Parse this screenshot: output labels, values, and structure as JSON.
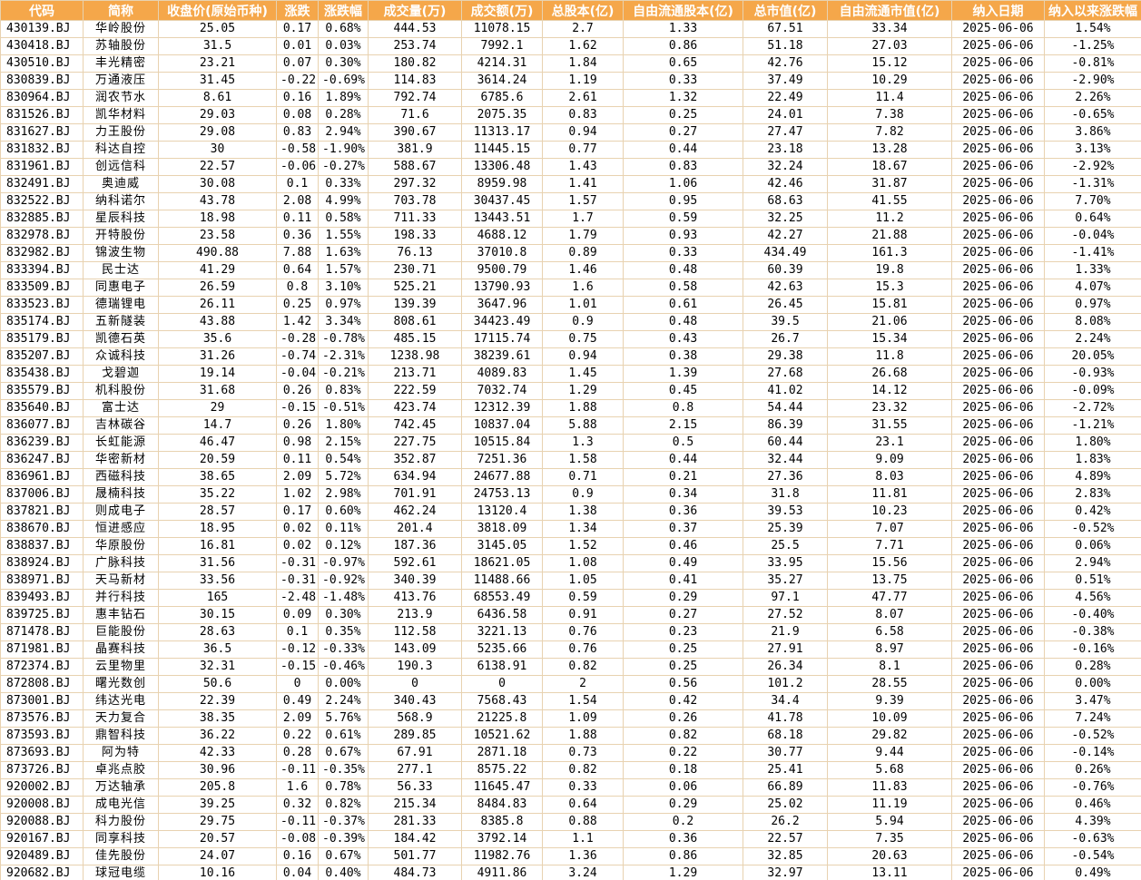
{
  "header": [
    "代码",
    "简称",
    "收盘价(原始币种)",
    "涨跌",
    "涨跌幅",
    "成交量(万)",
    "成交额(万)",
    "总股本(亿)",
    "自由流通股本(亿)",
    "总市值(亿)",
    "自由流通市值(亿)",
    "纳入日期",
    "纳入以来涨跌幅"
  ],
  "rows": [
    [
      "430139.BJ",
      "华岭股份",
      "25.05",
      "0.17",
      "0.68%",
      "444.53",
      "11078.15",
      "2.7",
      "1.33",
      "67.51",
      "33.34",
      "2025-06-06",
      "1.54%"
    ],
    [
      "430418.BJ",
      "苏轴股份",
      "31.5",
      "0.01",
      "0.03%",
      "253.74",
      "7992.1",
      "1.62",
      "0.86",
      "51.18",
      "27.03",
      "2025-06-06",
      "-1.25%"
    ],
    [
      "430510.BJ",
      "丰光精密",
      "23.21",
      "0.07",
      "0.30%",
      "180.82",
      "4214.31",
      "1.84",
      "0.65",
      "42.76",
      "15.12",
      "2025-06-06",
      "-0.81%"
    ],
    [
      "830839.BJ",
      "万通液压",
      "31.45",
      "-0.22",
      "-0.69%",
      "114.83",
      "3614.24",
      "1.19",
      "0.33",
      "37.49",
      "10.29",
      "2025-06-06",
      "-2.90%"
    ],
    [
      "830964.BJ",
      "润农节水",
      "8.61",
      "0.16",
      "1.89%",
      "792.74",
      "6785.6",
      "2.61",
      "1.32",
      "22.49",
      "11.4",
      "2025-06-06",
      "2.26%"
    ],
    [
      "831526.BJ",
      "凯华材料",
      "29.03",
      "0.08",
      "0.28%",
      "71.6",
      "2075.35",
      "0.83",
      "0.25",
      "24.01",
      "7.38",
      "2025-06-06",
      "-0.65%"
    ],
    [
      "831627.BJ",
      "力王股份",
      "29.08",
      "0.83",
      "2.94%",
      "390.67",
      "11313.17",
      "0.94",
      "0.27",
      "27.47",
      "7.82",
      "2025-06-06",
      "3.86%"
    ],
    [
      "831832.BJ",
      "科达自控",
      "30",
      "-0.58",
      "-1.90%",
      "381.9",
      "11445.15",
      "0.77",
      "0.44",
      "23.18",
      "13.28",
      "2025-06-06",
      "3.13%"
    ],
    [
      "831961.BJ",
      "创远信科",
      "22.57",
      "-0.06",
      "-0.27%",
      "588.67",
      "13306.48",
      "1.43",
      "0.83",
      "32.24",
      "18.67",
      "2025-06-06",
      "-2.92%"
    ],
    [
      "832491.BJ",
      "奥迪威",
      "30.08",
      "0.1",
      "0.33%",
      "297.32",
      "8959.98",
      "1.41",
      "1.06",
      "42.46",
      "31.87",
      "2025-06-06",
      "-1.31%"
    ],
    [
      "832522.BJ",
      "纳科诺尔",
      "43.78",
      "2.08",
      "4.99%",
      "703.78",
      "30437.45",
      "1.57",
      "0.95",
      "68.63",
      "41.55",
      "2025-06-06",
      "7.70%"
    ],
    [
      "832885.BJ",
      "星辰科技",
      "18.98",
      "0.11",
      "0.58%",
      "711.33",
      "13443.51",
      "1.7",
      "0.59",
      "32.25",
      "11.2",
      "2025-06-06",
      "0.64%"
    ],
    [
      "832978.BJ",
      "开特股份",
      "23.58",
      "0.36",
      "1.55%",
      "198.33",
      "4688.12",
      "1.79",
      "0.93",
      "42.27",
      "21.88",
      "2025-06-06",
      "-0.04%"
    ],
    [
      "832982.BJ",
      "锦波生物",
      "490.88",
      "7.88",
      "1.63%",
      "76.13",
      "37010.8",
      "0.89",
      "0.33",
      "434.49",
      "161.3",
      "2025-06-06",
      "-1.41%"
    ],
    [
      "833394.BJ",
      "民士达",
      "41.29",
      "0.64",
      "1.57%",
      "230.71",
      "9500.79",
      "1.46",
      "0.48",
      "60.39",
      "19.8",
      "2025-06-06",
      "1.33%"
    ],
    [
      "833509.BJ",
      "同惠电子",
      "26.59",
      "0.8",
      "3.10%",
      "525.21",
      "13790.93",
      "1.6",
      "0.58",
      "42.63",
      "15.3",
      "2025-06-06",
      "4.07%"
    ],
    [
      "833523.BJ",
      "德瑞锂电",
      "26.11",
      "0.25",
      "0.97%",
      "139.39",
      "3647.96",
      "1.01",
      "0.61",
      "26.45",
      "15.81",
      "2025-06-06",
      "0.97%"
    ],
    [
      "835174.BJ",
      "五新隧装",
      "43.88",
      "1.42",
      "3.34%",
      "808.61",
      "34423.49",
      "0.9",
      "0.48",
      "39.5",
      "21.06",
      "2025-06-06",
      "8.08%"
    ],
    [
      "835179.BJ",
      "凯德石英",
      "35.6",
      "-0.28",
      "-0.78%",
      "485.15",
      "17115.74",
      "0.75",
      "0.43",
      "26.7",
      "15.34",
      "2025-06-06",
      "2.24%"
    ],
    [
      "835207.BJ",
      "众诚科技",
      "31.26",
      "-0.74",
      "-2.31%",
      "1238.98",
      "38239.61",
      "0.94",
      "0.38",
      "29.38",
      "11.8",
      "2025-06-06",
      "20.05%"
    ],
    [
      "835438.BJ",
      "戈碧迦",
      "19.14",
      "-0.04",
      "-0.21%",
      "213.71",
      "4089.83",
      "1.45",
      "1.39",
      "27.68",
      "26.68",
      "2025-06-06",
      "-0.93%"
    ],
    [
      "835579.BJ",
      "机科股份",
      "31.68",
      "0.26",
      "0.83%",
      "222.59",
      "7032.74",
      "1.29",
      "0.45",
      "41.02",
      "14.12",
      "2025-06-06",
      "-0.09%"
    ],
    [
      "835640.BJ",
      "富士达",
      "29",
      "-0.15",
      "-0.51%",
      "423.74",
      "12312.39",
      "1.88",
      "0.8",
      "54.44",
      "23.32",
      "2025-06-06",
      "-2.72%"
    ],
    [
      "836077.BJ",
      "吉林碳谷",
      "14.7",
      "0.26",
      "1.80%",
      "742.45",
      "10837.04",
      "5.88",
      "2.15",
      "86.39",
      "31.55",
      "2025-06-06",
      "-1.21%"
    ],
    [
      "836239.BJ",
      "长虹能源",
      "46.47",
      "0.98",
      "2.15%",
      "227.75",
      "10515.84",
      "1.3",
      "0.5",
      "60.44",
      "23.1",
      "2025-06-06",
      "1.80%"
    ],
    [
      "836247.BJ",
      "华密新材",
      "20.59",
      "0.11",
      "0.54%",
      "352.87",
      "7251.36",
      "1.58",
      "0.44",
      "32.44",
      "9.09",
      "2025-06-06",
      "1.83%"
    ],
    [
      "836961.BJ",
      "西磁科技",
      "38.65",
      "2.09",
      "5.72%",
      "634.94",
      "24677.88",
      "0.71",
      "0.21",
      "27.36",
      "8.03",
      "2025-06-06",
      "4.89%"
    ],
    [
      "837006.BJ",
      "晟楠科技",
      "35.22",
      "1.02",
      "2.98%",
      "701.91",
      "24753.13",
      "0.9",
      "0.34",
      "31.8",
      "11.81",
      "2025-06-06",
      "2.83%"
    ],
    [
      "837821.BJ",
      "则成电子",
      "28.57",
      "0.17",
      "0.60%",
      "462.24",
      "13120.4",
      "1.38",
      "0.36",
      "39.53",
      "10.23",
      "2025-06-06",
      "0.42%"
    ],
    [
      "838670.BJ",
      "恒进感应",
      "18.95",
      "0.02",
      "0.11%",
      "201.4",
      "3818.09",
      "1.34",
      "0.37",
      "25.39",
      "7.07",
      "2025-06-06",
      "-0.52%"
    ],
    [
      "838837.BJ",
      "华原股份",
      "16.81",
      "0.02",
      "0.12%",
      "187.36",
      "3145.05",
      "1.52",
      "0.46",
      "25.5",
      "7.71",
      "2025-06-06",
      "0.06%"
    ],
    [
      "838924.BJ",
      "广脉科技",
      "31.56",
      "-0.31",
      "-0.97%",
      "592.61",
      "18621.05",
      "1.08",
      "0.49",
      "33.95",
      "15.56",
      "2025-06-06",
      "2.94%"
    ],
    [
      "838971.BJ",
      "天马新材",
      "33.56",
      "-0.31",
      "-0.92%",
      "340.39",
      "11488.66",
      "1.05",
      "0.41",
      "35.27",
      "13.75",
      "2025-06-06",
      "0.51%"
    ],
    [
      "839493.BJ",
      "并行科技",
      "165",
      "-2.48",
      "-1.48%",
      "413.76",
      "68553.49",
      "0.59",
      "0.29",
      "97.1",
      "47.77",
      "2025-06-06",
      "4.56%"
    ],
    [
      "839725.BJ",
      "惠丰钻石",
      "30.15",
      "0.09",
      "0.30%",
      "213.9",
      "6436.58",
      "0.91",
      "0.27",
      "27.52",
      "8.07",
      "2025-06-06",
      "-0.40%"
    ],
    [
      "871478.BJ",
      "巨能股份",
      "28.63",
      "0.1",
      "0.35%",
      "112.58",
      "3221.13",
      "0.76",
      "0.23",
      "21.9",
      "6.58",
      "2025-06-06",
      "-0.38%"
    ],
    [
      "871981.BJ",
      "晶赛科技",
      "36.5",
      "-0.12",
      "-0.33%",
      "143.09",
      "5235.66",
      "0.76",
      "0.25",
      "27.91",
      "8.97",
      "2025-06-06",
      "-0.16%"
    ],
    [
      "872374.BJ",
      "云里物里",
      "32.31",
      "-0.15",
      "-0.46%",
      "190.3",
      "6138.91",
      "0.82",
      "0.25",
      "26.34",
      "8.1",
      "2025-06-06",
      "0.28%"
    ],
    [
      "872808.BJ",
      "曙光数创",
      "50.6",
      "0",
      "0.00%",
      "0",
      "0",
      "2",
      "0.56",
      "101.2",
      "28.55",
      "2025-06-06",
      "0.00%"
    ],
    [
      "873001.BJ",
      "纬达光电",
      "22.39",
      "0.49",
      "2.24%",
      "340.43",
      "7568.43",
      "1.54",
      "0.42",
      "34.4",
      "9.39",
      "2025-06-06",
      "3.47%"
    ],
    [
      "873576.BJ",
      "天力复合",
      "38.35",
      "2.09",
      "5.76%",
      "568.9",
      "21225.8",
      "1.09",
      "0.26",
      "41.78",
      "10.09",
      "2025-06-06",
      "7.24%"
    ],
    [
      "873593.BJ",
      "鼎智科技",
      "36.22",
      "0.22",
      "0.61%",
      "289.85",
      "10521.62",
      "1.88",
      "0.82",
      "68.18",
      "29.82",
      "2025-06-06",
      "-0.52%"
    ],
    [
      "873693.BJ",
      "阿为特",
      "42.33",
      "0.28",
      "0.67%",
      "67.91",
      "2871.18",
      "0.73",
      "0.22",
      "30.77",
      "9.44",
      "2025-06-06",
      "-0.14%"
    ],
    [
      "873726.BJ",
      "卓兆点胶",
      "30.96",
      "-0.11",
      "-0.35%",
      "277.1",
      "8575.22",
      "0.82",
      "0.18",
      "25.41",
      "5.68",
      "2025-06-06",
      "0.26%"
    ],
    [
      "920002.BJ",
      "万达轴承",
      "205.8",
      "1.6",
      "0.78%",
      "56.33",
      "11645.47",
      "0.33",
      "0.06",
      "66.89",
      "11.83",
      "2025-06-06",
      "-0.76%"
    ],
    [
      "920008.BJ",
      "成电光信",
      "39.25",
      "0.32",
      "0.82%",
      "215.34",
      "8484.83",
      "0.64",
      "0.29",
      "25.02",
      "11.19",
      "2025-06-06",
      "0.46%"
    ],
    [
      "920088.BJ",
      "科力股份",
      "29.75",
      "-0.11",
      "-0.37%",
      "281.33",
      "8385.8",
      "0.88",
      "0.2",
      "26.2",
      "5.94",
      "2025-06-06",
      "4.39%"
    ],
    [
      "920167.BJ",
      "同享科技",
      "20.57",
      "-0.08",
      "-0.39%",
      "184.42",
      "3792.14",
      "1.1",
      "0.36",
      "22.57",
      "7.35",
      "2025-06-06",
      "-0.63%"
    ],
    [
      "920489.BJ",
      "佳先股份",
      "24.07",
      "0.16",
      "0.67%",
      "501.77",
      "11982.76",
      "1.36",
      "0.86",
      "32.85",
      "20.63",
      "2025-06-06",
      "-0.54%"
    ],
    [
      "920682.BJ",
      "球冠电缆",
      "10.16",
      "0.04",
      "0.40%",
      "484.73",
      "4911.86",
      "3.24",
      "1.29",
      "32.97",
      "13.11",
      "2025-06-06",
      "0.49%"
    ]
  ]
}
